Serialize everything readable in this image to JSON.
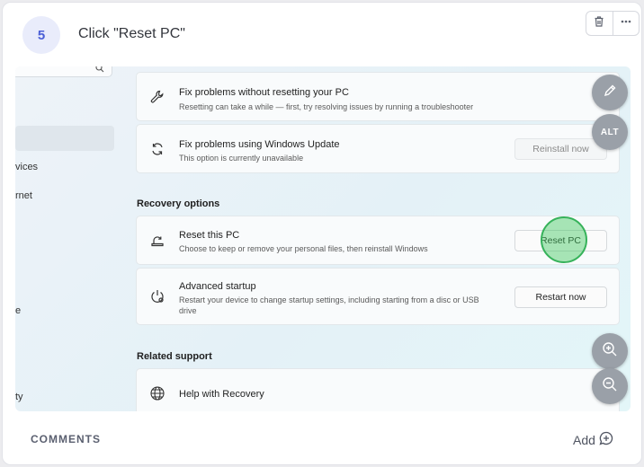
{
  "step": {
    "number": "5",
    "title": "Click \"Reset PC\""
  },
  "toolbar": {
    "delete_icon": "trash-icon",
    "more_icon": "more-horizontal-icon"
  },
  "screenshot": {
    "sidebar": {
      "search_icon": "search-icon",
      "items": [
        "vices",
        "rnet",
        "e",
        "ty"
      ]
    },
    "fix_items": [
      {
        "icon": "wrench-icon",
        "title": "Fix problems without resetting your PC",
        "description": "Resetting can take a while — first, try resolving issues by running a troubleshooter"
      },
      {
        "icon": "sync-icon",
        "title": "Fix problems using Windows Update",
        "description": "This option is currently unavailable",
        "button": "Reinstall now"
      }
    ],
    "recovery_heading": "Recovery options",
    "recovery_items": [
      {
        "icon": "reset-pc-icon",
        "title": "Reset this PC",
        "description": "Choose to keep or remove your personal files, then reinstall Windows",
        "button": "Reset PC"
      },
      {
        "icon": "advanced-startup-icon",
        "title": "Advanced startup",
        "description": "Restart your device to change startup settings, including starting from a disc or USB drive",
        "button": "Restart now"
      }
    ],
    "related_heading": "Related support",
    "related_items": [
      {
        "icon": "globe-icon",
        "title": "Help with Recovery"
      }
    ]
  },
  "overlay": {
    "edit_icon": "pencil-icon",
    "alt_label": "ALT",
    "zoom_in_icon": "zoom-in-icon",
    "zoom_out_icon": "zoom-out-icon",
    "click_marker_color": "#40c860"
  },
  "footer": {
    "comments_label": "COMMENTS",
    "add_label": "Add"
  }
}
